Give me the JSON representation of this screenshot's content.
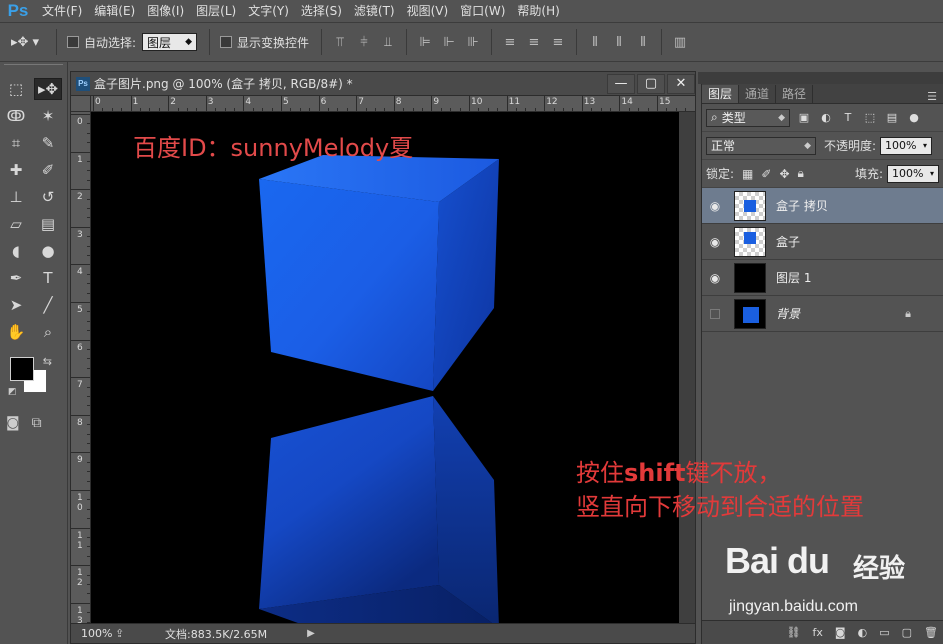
{
  "app": {
    "logo": "Ps"
  },
  "menu": [
    "文件(F)",
    "编辑(E)",
    "图像(I)",
    "图层(L)",
    "文字(Y)",
    "选择(S)",
    "滤镜(T)",
    "视图(V)",
    "窗口(W)",
    "帮助(H)"
  ],
  "options": {
    "auto_select_label": "自动选择:",
    "auto_select_value": "图层",
    "show_transform_label": "显示变换控件"
  },
  "document": {
    "title": "盒子图片.png @ 100% (盒子 拷贝, RGB/8#) *",
    "zoom": "100%",
    "doc_size": "文档:883.5K/2.65M",
    "ruler_top": [
      "0",
      "1",
      "2",
      "3",
      "4",
      "5",
      "6",
      "7",
      "8",
      "9",
      "10",
      "11",
      "12",
      "13",
      "14",
      "15"
    ],
    "ruler_left": [
      "0",
      "1",
      "2",
      "3",
      "4",
      "5",
      "6",
      "7",
      "8",
      "9",
      "1 0",
      "1 1",
      "1 2",
      "1 3"
    ],
    "annotation_top": "百度ID：sunnyMelody夏",
    "annotation_right_line1_a": "按住",
    "annotation_right_line1_b": "shift",
    "annotation_right_line1_c": "键不放，",
    "annotation_right_line2": "竖直向下移动到合适的位置"
  },
  "layers_panel": {
    "tabs": [
      "图层",
      "通道",
      "路径"
    ],
    "filter_kind": "类型",
    "blend_mode": "正常",
    "opacity_label": "不透明度:",
    "opacity_value": "100%",
    "lock_label": "锁定:",
    "fill_label": "填充:",
    "fill_value": "100%",
    "layers": [
      {
        "name": "盒子 拷贝",
        "visible": true,
        "selected": true
      },
      {
        "name": "盒子",
        "visible": true,
        "selected": false
      },
      {
        "name": "图层 1",
        "visible": true,
        "selected": false
      },
      {
        "name": "背景",
        "visible": false,
        "selected": false,
        "locked": true
      }
    ]
  },
  "watermark": {
    "logo": "Bai du",
    "cn": "经验",
    "url": "jingyan.baidu.com"
  },
  "colors": {
    "cube_blue": "#1858d8",
    "annotation_red": "#e23a3a",
    "canvas_bg": "#000000"
  }
}
